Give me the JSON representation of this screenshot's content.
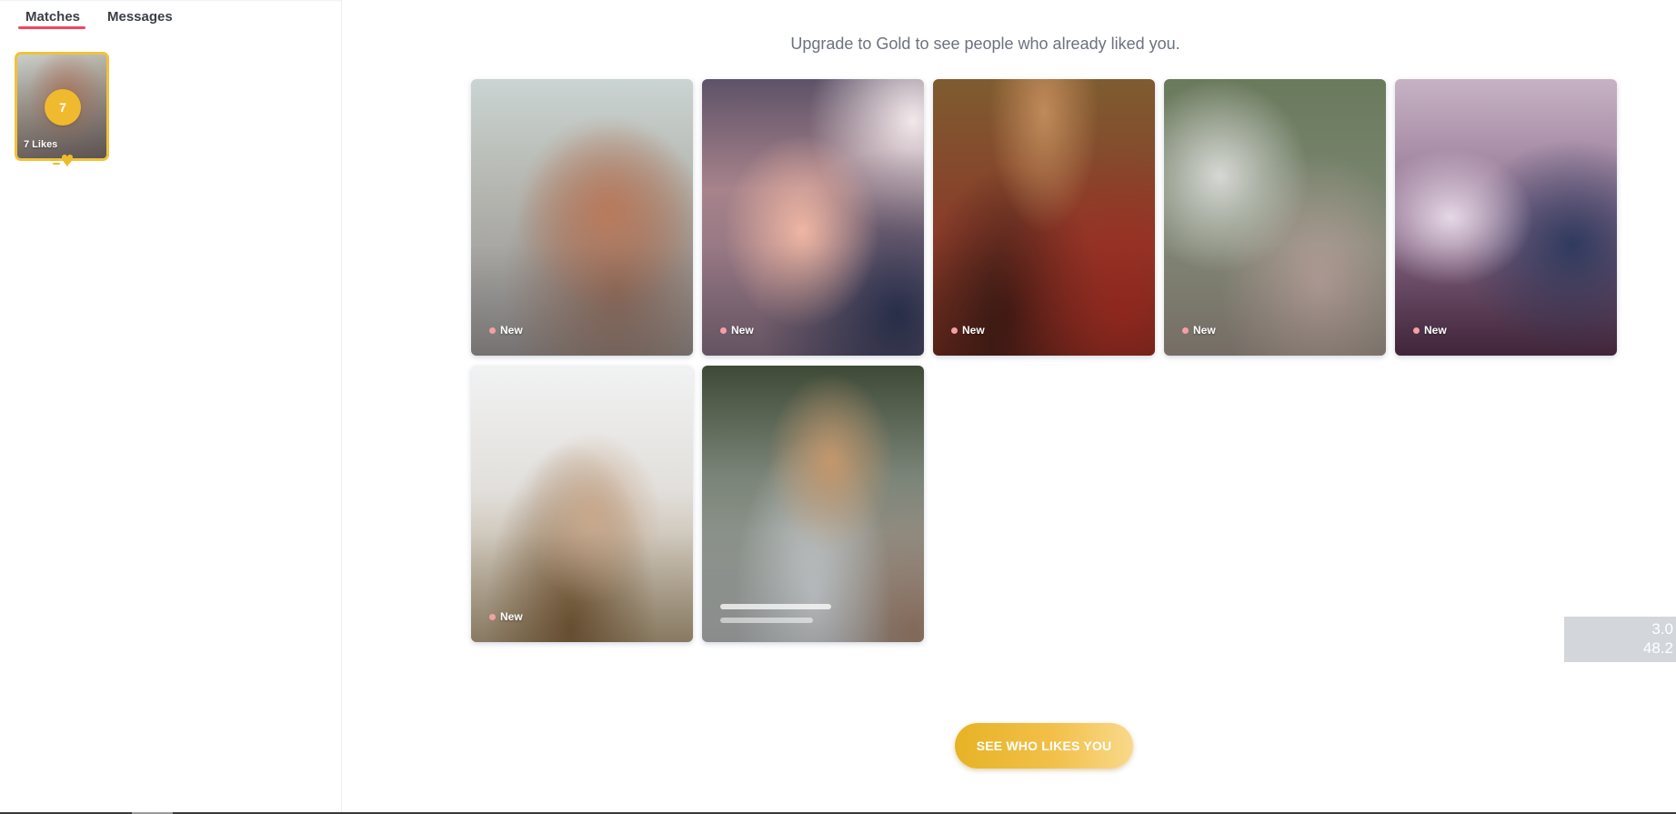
{
  "sidebar": {
    "tabs": [
      {
        "label": "Matches",
        "active": true
      },
      {
        "label": "Messages",
        "active": false
      }
    ],
    "likes_tile": {
      "count": "7",
      "label": "7 Likes"
    }
  },
  "main": {
    "upgrade_text": "Upgrade to Gold to see people who already liked you.",
    "cards": [
      {
        "tag": "New"
      },
      {
        "tag": "New"
      },
      {
        "tag": "New"
      },
      {
        "tag": "New"
      },
      {
        "tag": "New"
      },
      {
        "tag": "New"
      },
      {
        "tag": ""
      }
    ],
    "cta_label": "SEE WHO LIKES YOU"
  },
  "overlay": {
    "line1": "3.0",
    "line2": "48.2"
  },
  "colors": {
    "accent_red": "#f0465f",
    "gold": "#f0ba2e",
    "new_dot": "#f5a0a6"
  }
}
